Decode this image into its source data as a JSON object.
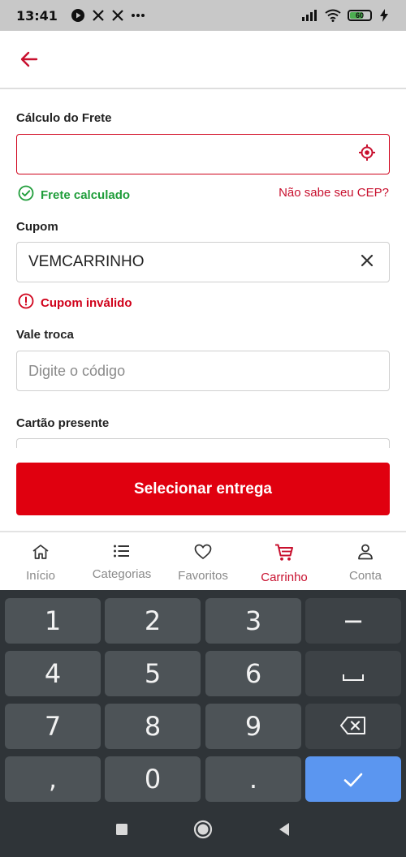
{
  "status_bar": {
    "time": "13:41",
    "battery_level": "60",
    "icons": [
      "youtube-icon",
      "x-icon",
      "x-icon",
      "more-icon",
      "signal-icon",
      "wifi-icon",
      "battery-icon",
      "charging-icon"
    ]
  },
  "header": {
    "back_icon": "arrow-left-icon"
  },
  "shipping": {
    "label": "Cálculo do Frete",
    "value": "",
    "icon": "locate-icon",
    "status_text": "Frete calculado",
    "help_link": "Não sabe seu CEP?"
  },
  "coupon": {
    "label": "Cupom",
    "value": "VEMCARRINHO",
    "clear_icon": "close-icon",
    "error_text": "Cupom inválido"
  },
  "exchange_voucher": {
    "label": "Vale troca",
    "placeholder": "Digite o código"
  },
  "gift_card": {
    "label": "Cartão presente"
  },
  "cta": {
    "label": "Selecionar entrega"
  },
  "bottom_nav": {
    "items": [
      {
        "label": "Início",
        "icon": "home-icon",
        "active": false
      },
      {
        "label": "Categorias",
        "icon": "list-icon",
        "active": false
      },
      {
        "label": "Favoritos",
        "icon": "heart-icon",
        "active": false
      },
      {
        "label": "Carrinho",
        "icon": "cart-icon",
        "active": true
      },
      {
        "label": "Conta",
        "icon": "user-icon",
        "active": false
      }
    ]
  },
  "keyboard": {
    "keys": [
      "1",
      "2",
      "3",
      "−",
      "4",
      "5",
      "6",
      "␣",
      "7",
      "8",
      "9",
      "⌫",
      ",",
      "0",
      ".",
      "✓"
    ]
  },
  "colors": {
    "brand_red": "#e0000f",
    "error_red": "#d0021b",
    "success_green": "#1f9d3a",
    "keyboard_bg": "#2f3438",
    "key_bg": "#4d5357",
    "confirm_key": "#5b96f0"
  }
}
